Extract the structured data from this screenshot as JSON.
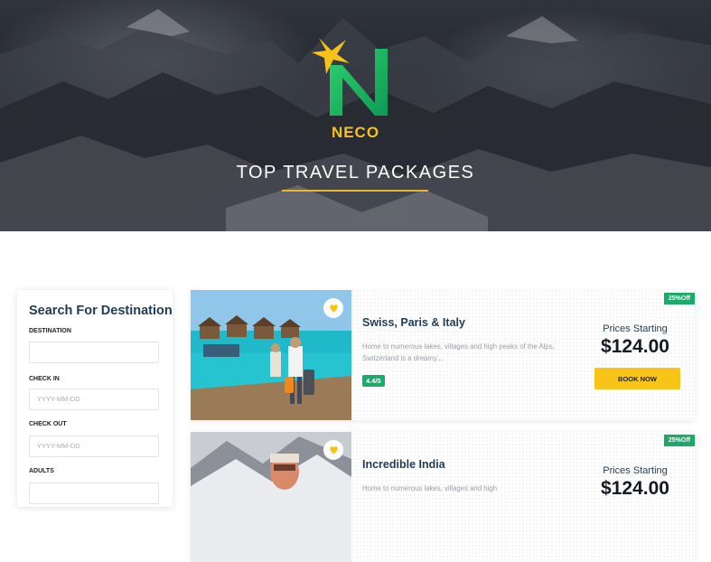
{
  "hero": {
    "brand": "NECO",
    "title": "TOP TRAVEL PACKAGES"
  },
  "search": {
    "title": "Search For Destination",
    "destination_label": "DESTINATION",
    "destination_value": "",
    "checkin_label": "CHECK IN",
    "checkin_placeholder": "YYYY-MM-DD",
    "checkout_label": "CHECK OUT",
    "checkout_placeholder": "YYYY-MM-DD",
    "adults_label": "ADULTS"
  },
  "packages": [
    {
      "discount": "25%Off",
      "title": "Swiss, Paris & Italy",
      "description": "Home to numerous lakes, villages and high peaks of the Alps, Switzerland is a dreamy...",
      "rating": "4.4/5",
      "price_label": "Prices Starting",
      "price": "$124.00",
      "button": "BOOK NOW"
    },
    {
      "discount": "25%Off",
      "title": "Incredible India",
      "description": "Home to numerous lakes, villages and high",
      "price_label": "Prices Starting",
      "price": "$124.00"
    }
  ],
  "colors": {
    "accent": "#f9c41a",
    "green": "#1aaa6a",
    "heading": "#1f3b57"
  }
}
